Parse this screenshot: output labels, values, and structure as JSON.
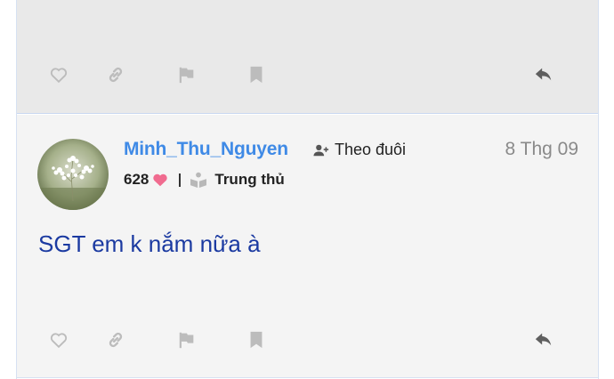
{
  "post": {
    "author": "Minh_Thu_Nguyen",
    "follow_label": "Theo đuôi",
    "date": "8 Thg 09",
    "likes": "628",
    "badge": "Trung thủ",
    "content": "SGT em k nắm nữa à"
  },
  "colors": {
    "username": "#3f8ae6",
    "content": "#1b3aa1",
    "heart": "#f06b8f",
    "action_icon": "#bcbcbc",
    "reply_icon": "#5f5f5f"
  },
  "icons": [
    "heart-icon",
    "link-icon",
    "flag-icon",
    "bookmark-icon",
    "reply-icon",
    "follow-user-icon",
    "reader-icon"
  ]
}
